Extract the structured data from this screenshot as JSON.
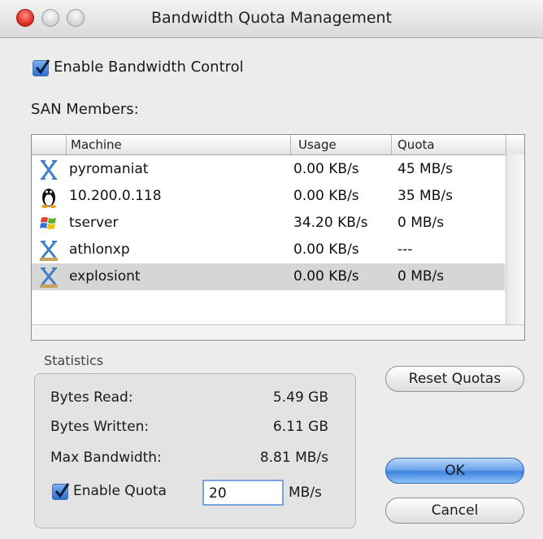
{
  "window": {
    "title": "Bandwidth Quota Management"
  },
  "enable_control": {
    "label": "Enable Bandwidth Control",
    "checked": true
  },
  "san": {
    "label": "SAN Members:",
    "columns": [
      "Machine",
      "Usage",
      "Quota"
    ],
    "rows": [
      {
        "icon": "mac-os-x-icon",
        "machine": "pyromaniat",
        "usage": "0.00 KB/s",
        "quota": "45 MB/s",
        "selected": false
      },
      {
        "icon": "linux-penguin-icon",
        "machine": "10.200.0.118",
        "usage": "0.00 KB/s",
        "quota": "35 MB/s",
        "selected": false
      },
      {
        "icon": "windows-logo-icon",
        "machine": "tserver",
        "usage": "34.20 KB/s",
        "quota": "0 MB/s",
        "selected": false
      },
      {
        "icon": "mac-os-x-icon",
        "machine": "athlonxp",
        "usage": "0.00 KB/s",
        "quota": "---",
        "selected": false
      },
      {
        "icon": "mac-os-x-icon",
        "machine": "explosiont",
        "usage": "0.00 KB/s",
        "quota": "0 MB/s",
        "selected": true
      }
    ]
  },
  "statistics": {
    "title": "Statistics",
    "bytes_read_label": "Bytes Read:",
    "bytes_read": "5.49 GB",
    "bytes_written_label": "Bytes Written:",
    "bytes_written": "6.11 GB",
    "max_bandwidth_label": "Max Bandwidth:",
    "max_bandwidth": "8.81 MB/s",
    "enable_quota_label": "Enable Quota",
    "enable_quota_checked": true,
    "quota_value": "20",
    "quota_unit": "MB/s"
  },
  "buttons": {
    "reset": "Reset Quotas",
    "ok": "OK",
    "cancel": "Cancel"
  },
  "colors": {
    "accent": "#3f84df",
    "close": "#d8271c",
    "selection": "#d6d6d6"
  }
}
